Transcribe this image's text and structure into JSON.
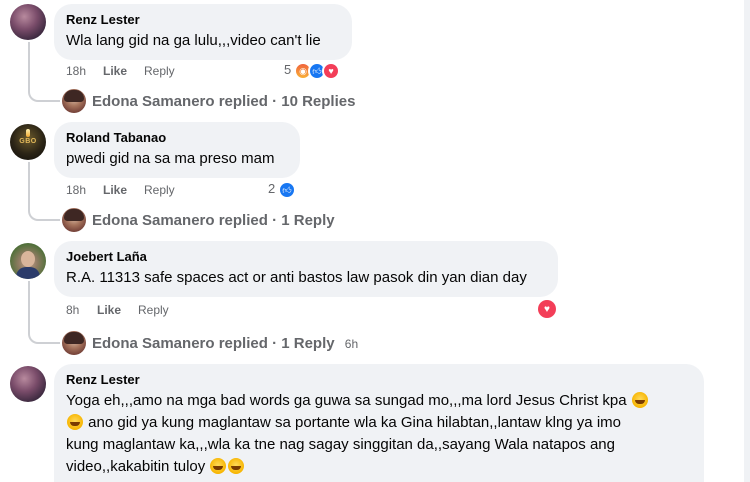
{
  "comments": [
    {
      "author": "Renz Lester",
      "text": "Wla lang gid na ga lulu,,,video can't lie",
      "time": "18h",
      "like_label": "Like",
      "reply_label": "Reply",
      "reaction_count": "5",
      "reactions": [
        "angry-icon",
        "like-icon",
        "love-icon"
      ],
      "replies": {
        "author_line": "Edona Samanero replied · 10 Replies",
        "author": "Edona Samanero",
        "label": "replied · 10 Replies"
      }
    },
    {
      "author": "Roland Tabanao",
      "avatar_text": "GBO",
      "text": "pwedi gid na sa ma preso mam",
      "time": "18h",
      "like_label": "Like",
      "reply_label": "Reply",
      "reaction_count": "2",
      "reactions": [
        "like-icon"
      ],
      "replies": {
        "author": "Edona Samanero",
        "label": "replied · 1 Reply"
      }
    },
    {
      "author": "Joebert Laña",
      "text": "R.A. 11313 safe spaces act or anti bastos law pasok din yan dian day",
      "time": "8h",
      "like_label": "Like",
      "reply_label": "Reply",
      "reaction_count": "",
      "reactions": [
        "love-icon"
      ],
      "replies": {
        "author": "Edona Samanero",
        "label": "replied · 1 Reply",
        "time": "6h"
      }
    },
    {
      "author": "Renz Lester",
      "text_lines": [
        "Yoga eh,,,amo na mga bad words ga guwa sa sungad mo,,,ma lord Jesus Christ kpa",
        "ano gid ya kung maglantaw sa portante wla ka Gina hilabtan,,lantaw klng ya imo",
        "kung maglantaw ka,,,wla ka tne nag sagay singgitan da,,sayang Wala natapos ang",
        "video,,kakabitin tuloy"
      ]
    }
  ]
}
